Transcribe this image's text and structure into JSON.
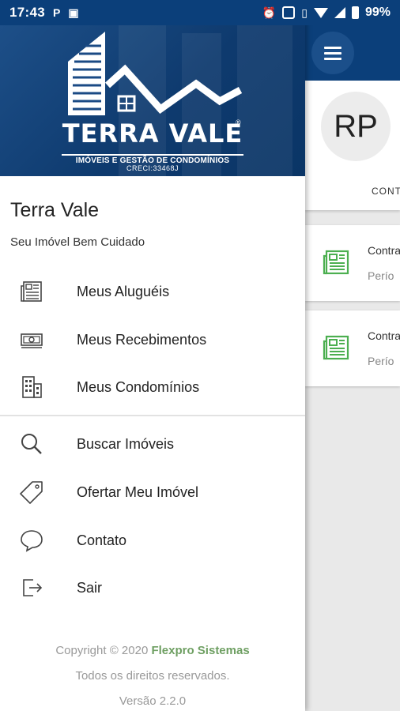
{
  "status_bar": {
    "time": "17:43",
    "notif_icons": [
      "parking-icon",
      "translate-icon"
    ],
    "system_icons": [
      "alarm-icon",
      "screen-icon",
      "vibrate-icon",
      "wifi-icon",
      "signal-icon",
      "battery-icon"
    ],
    "battery_percent": "99%"
  },
  "drawer": {
    "logo": {
      "title": "TERRA VALE",
      "registered": "®",
      "subtitle": "IMÓVEIS E GESTÃO DE CONDOMÍNIOS",
      "creci": "CRECI:33468J"
    },
    "brand_name": "Terra Vale",
    "tagline": "Seu Imóvel Bem Cuidado",
    "menu_primary": [
      {
        "label": "Meus Aluguéis",
        "icon": "newspaper-icon"
      },
      {
        "label": "Meus Recebimentos",
        "icon": "money-icon"
      },
      {
        "label": "Meus Condomínios",
        "icon": "building-icon"
      }
    ],
    "menu_secondary": [
      {
        "label": "Buscar Imóveis",
        "icon": "search-icon"
      },
      {
        "label": "Ofertar Meu Imóvel",
        "icon": "tag-icon"
      },
      {
        "label": "Contato",
        "icon": "chat-icon"
      },
      {
        "label": "Sair",
        "icon": "logout-icon"
      }
    ],
    "footer": {
      "copyright_prefix": "Copyright © 2020",
      "company": "Flexpro Sistemas",
      "rights": "Todos os direitos reservados.",
      "version": "Versão 2.2.0"
    }
  },
  "main": {
    "avatar_initials": "RP",
    "tab_label": "CONT",
    "cards": [
      {
        "title": "Contra",
        "subtitle": "Perío"
      },
      {
        "title": "Contra",
        "subtitle": "Perío"
      }
    ]
  },
  "colors": {
    "primary": "#0b3f7a",
    "accent_green": "#4caf50",
    "company_green": "#6e9f62"
  }
}
